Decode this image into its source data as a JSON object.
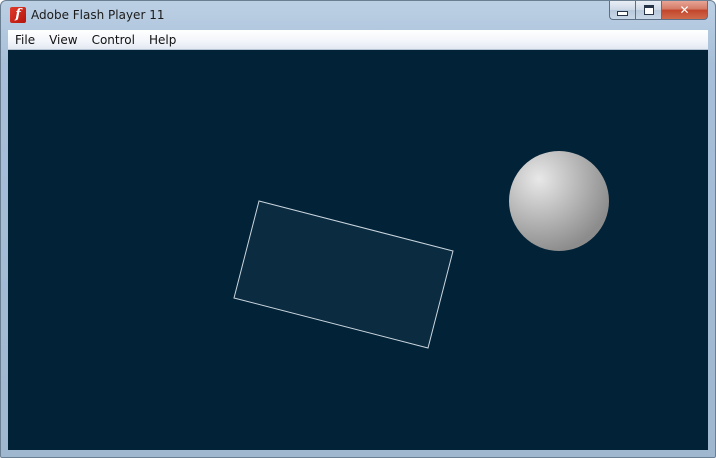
{
  "window": {
    "title": "Adobe Flash Player 11",
    "app_icon_glyph": "f",
    "controls": {
      "minimize_icon": "minimize-icon",
      "maximize_icon": "maximize-icon",
      "close_glyph": "✕"
    }
  },
  "menu": {
    "items": [
      "File",
      "View",
      "Control",
      "Help"
    ]
  },
  "stage": {
    "background_color": "#022237",
    "rectangle": {
      "fill": "#0b2b40",
      "stroke": "#c9d6df"
    },
    "sphere": {
      "highlight": "#e8e8e8",
      "shade": "#8c8c8c"
    }
  }
}
